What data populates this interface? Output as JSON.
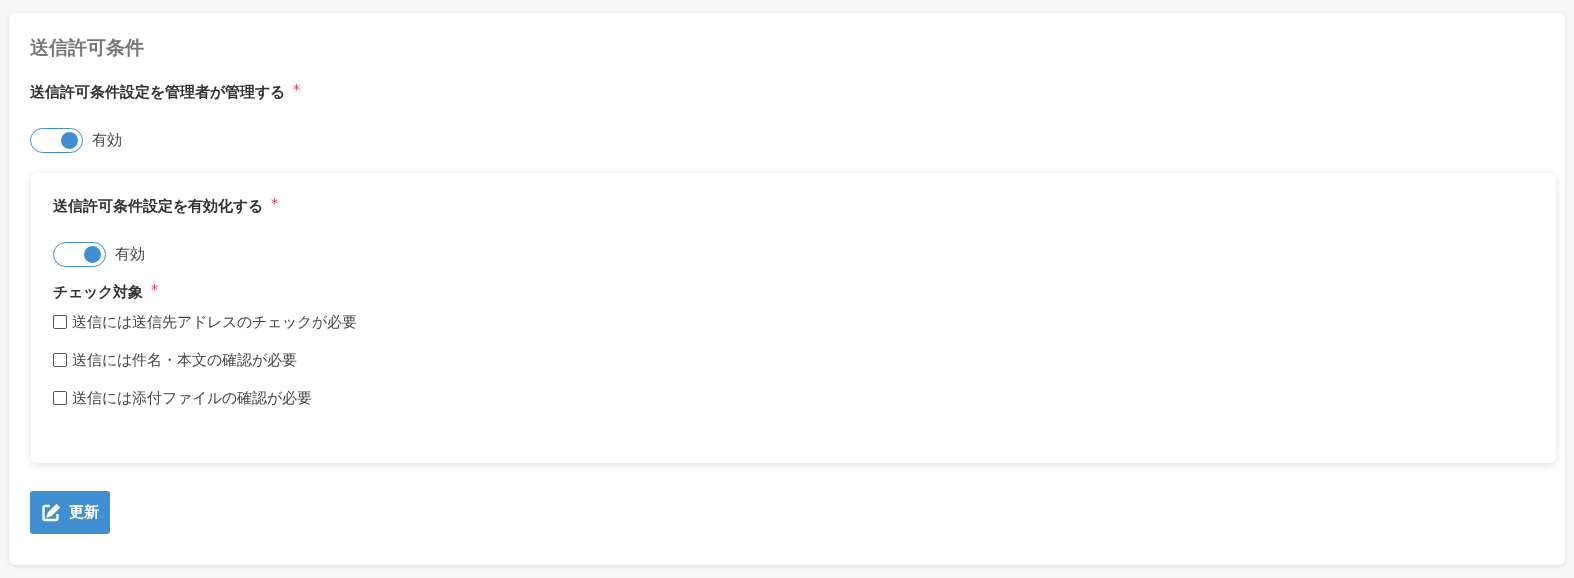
{
  "section_title": "送信許可条件",
  "admin_setting": {
    "label": "送信許可条件設定を管理者が管理する",
    "required_mark": "*",
    "on": true,
    "state_text": "有効"
  },
  "inner_card": {
    "enable_setting": {
      "label": "送信許可条件設定を有効化する",
      "required_mark": "*",
      "on": true,
      "state_text": "有効"
    },
    "check_targets": {
      "label": "チェック対象",
      "required_mark": "*",
      "options": [
        {
          "label": "送信には送信先アドレスのチェックが必要",
          "checked": false
        },
        {
          "label": "送信には件名・本文の確認が必要",
          "checked": false
        },
        {
          "label": "送信には添付ファイルの確認が必要",
          "checked": false
        }
      ]
    }
  },
  "update_button": "更新"
}
